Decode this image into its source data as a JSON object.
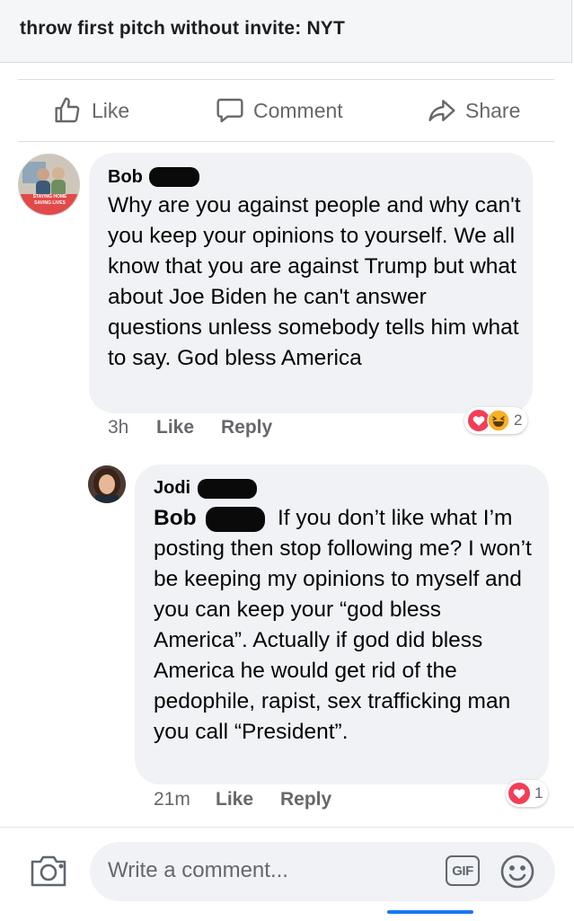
{
  "preview": {
    "title": "throw first pitch without invite: NYT"
  },
  "actions": {
    "like": "Like",
    "comment": "Comment",
    "share": "Share"
  },
  "comments": [
    {
      "author_first": "Bob",
      "avatar_caption": "STAYING HOME SAVING LIVES",
      "text": "Why are you against people and why can't you keep your opinions to yourself. We all know that you are against Trump but what about Joe Biden he can't answer questions unless somebody tells him what to say. God bless America",
      "time": "3h",
      "like": "Like",
      "reply": "Reply",
      "reaction_count": "2",
      "reactions": [
        "heart",
        "laughing"
      ]
    },
    {
      "author_first": "Jodi",
      "mention_first": "Bob",
      "text": "If you don’t like what I’m posting then stop following me? I won’t be keeping my opinions to myself and you can keep your “god bless America”. Actually if god did bless America he would get rid of the pedophile, rapist, sex trafficking man you call “President”.",
      "time": "21m",
      "like": "Like",
      "reply": "Reply",
      "reaction_count": "1",
      "reactions": [
        "heart"
      ]
    }
  ],
  "composer": {
    "placeholder": "Write a comment...",
    "gif_label": "GIF"
  },
  "colors": {
    "bubble": "#f0f2f5",
    "secondary_text": "#65676b",
    "heart": "#f33e58",
    "haha": "#f7b125",
    "accent": "#1877f2"
  }
}
